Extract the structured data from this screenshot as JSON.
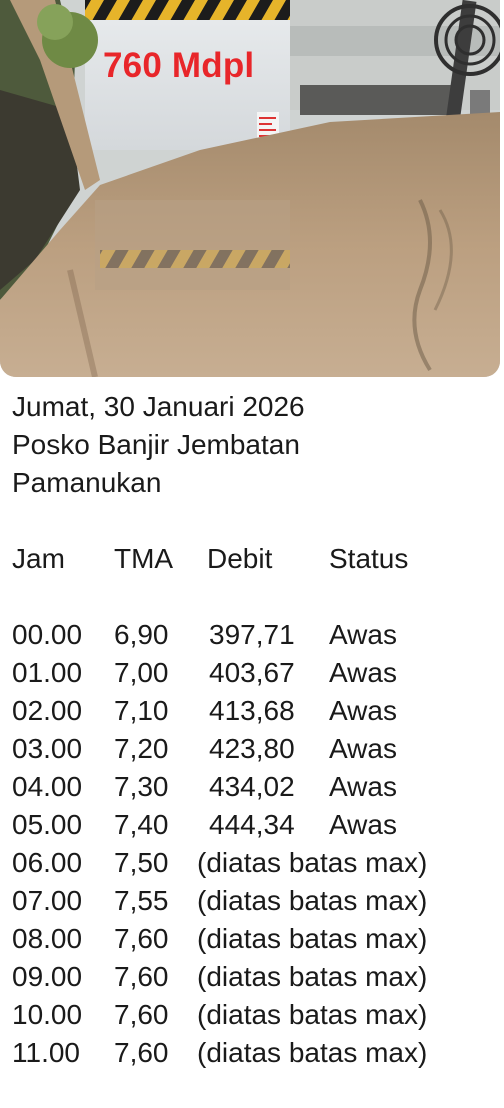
{
  "photo": {
    "overlay_label": "760 Mdpl",
    "overlay_color": "#e8262a"
  },
  "message": {
    "date": "Jumat, 30 Januari 2026",
    "location_line1": "Posko Banjir Jembatan",
    "location_line2": "Pamanukan",
    "columns": [
      "Jam",
      "TMA",
      "Debit",
      "Status"
    ],
    "rows": [
      {
        "jam": "00.00",
        "tma": "6,90",
        "debit": "397,71",
        "status": "Awas"
      },
      {
        "jam": "01.00",
        "tma": "7,00",
        "debit": "403,67",
        "status": "Awas"
      },
      {
        "jam": "02.00",
        "tma": "7,10",
        "debit": "413,68",
        "status": "Awas"
      },
      {
        "jam": "03.00",
        "tma": "7,20",
        "debit": "423,80",
        "status": "Awas"
      },
      {
        "jam": "04.00",
        "tma": "7,30",
        "debit": "434,02",
        "status": "Awas"
      },
      {
        "jam": "05.00",
        "tma": "7,40",
        "debit": "444,34",
        "status": "Awas"
      },
      {
        "jam": "06.00",
        "tma": "7,50",
        "note": "(diatas batas max)"
      },
      {
        "jam": "07.00",
        "tma": "7,55",
        "note": "(diatas batas max)"
      },
      {
        "jam": "08.00",
        "tma": "7,60",
        "note": "(diatas batas max)"
      },
      {
        "jam": "09.00",
        "tma": "7,60",
        "note": "(diatas batas max)"
      },
      {
        "jam": "10.00",
        "tma": "7,60",
        "note": "(diatas batas max)"
      },
      {
        "jam": "11.00",
        "tma": "7,60",
        "note": "(diatas batas max)"
      }
    ]
  }
}
